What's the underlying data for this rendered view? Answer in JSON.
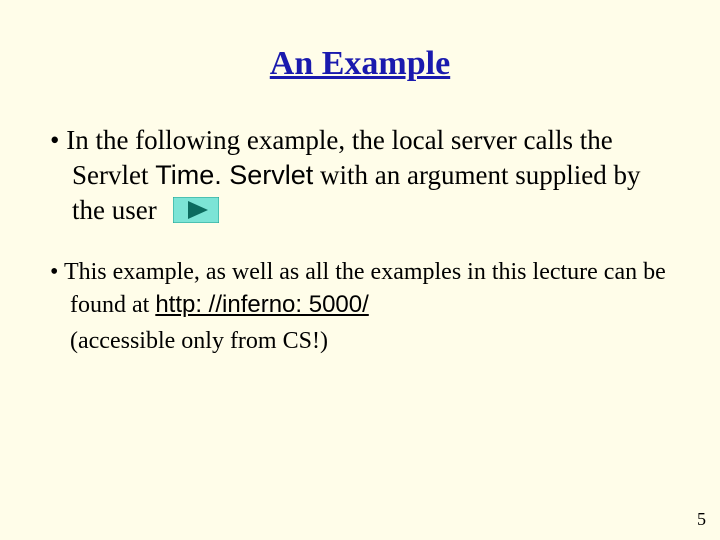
{
  "title": "An Example",
  "bullet1": {
    "pre": "In the following example, the local server calls the Servlet ",
    "code": "Time. Servlet",
    "post": " with an argument supplied by the user"
  },
  "bullet2": {
    "line1_pre": "This example, as well as all the examples in this lecture can be found at ",
    "link": "http: //inferno: 5000/",
    "line2": "(accessible only from CS!)"
  },
  "page_number": "5"
}
